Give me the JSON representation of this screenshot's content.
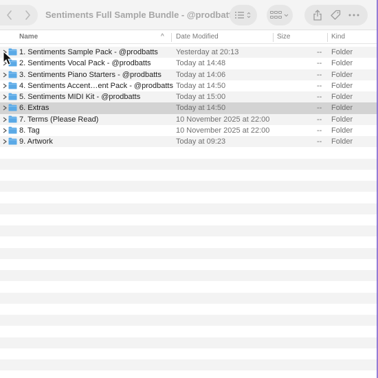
{
  "window": {
    "title": "Sentiments Full Sample Bundle - @prodbatts"
  },
  "toolbar": {
    "back_icon": "chevron-left-icon",
    "forward_icon": "chevron-right-icon",
    "view_list_icon": "list-view-icon",
    "view_grid_icon": "grid-view-icon",
    "share_icon": "share-icon",
    "tag_icon": "tag-icon",
    "more_icon": "ellipsis-icon"
  },
  "columns": {
    "name": "Name",
    "date_modified": "Date Modified",
    "size": "Size",
    "kind": "Kind",
    "sort_indicator": "^"
  },
  "files": [
    {
      "name": "1. Sentiments Sample Pack - @prodbatts",
      "date": "Yesterday at 20:13",
      "size": "--",
      "kind": "Folder"
    },
    {
      "name": "2. Sentiments Vocal Pack - @prodbatts",
      "date": "Today at 14:48",
      "size": "--",
      "kind": "Folder"
    },
    {
      "name": "3. Sentiments Piano Starters - @prodbatts",
      "date": "Today at 14:06",
      "size": "--",
      "kind": "Folder"
    },
    {
      "name": "4. Sentiments Accent…ent Pack - @prodbatts",
      "date": "Today at 14:50",
      "size": "--",
      "kind": "Folder"
    },
    {
      "name": "5. Sentiments MIDI Kit - @prodbatts",
      "date": "Today at 15:00",
      "size": "--",
      "kind": "Folder"
    },
    {
      "name": "6. Extras",
      "date": "Today at 14:50",
      "size": "--",
      "kind": "Folder",
      "selected": true
    },
    {
      "name": "7. Terms (Please Read)",
      "date": "10 November 2025 at 22:00",
      "size": "--",
      "kind": "Folder"
    },
    {
      "name": "8. Tag",
      "date": "10 November 2025 at 22:00",
      "size": "--",
      "kind": "Folder"
    },
    {
      "name": "9. Artwork",
      "date": "Today at 09:23",
      "size": "--",
      "kind": "Folder"
    }
  ],
  "colors": {
    "folder": "#5aa9e6",
    "selection": "#d3d3d3",
    "stripe": "#f3f3f3"
  }
}
